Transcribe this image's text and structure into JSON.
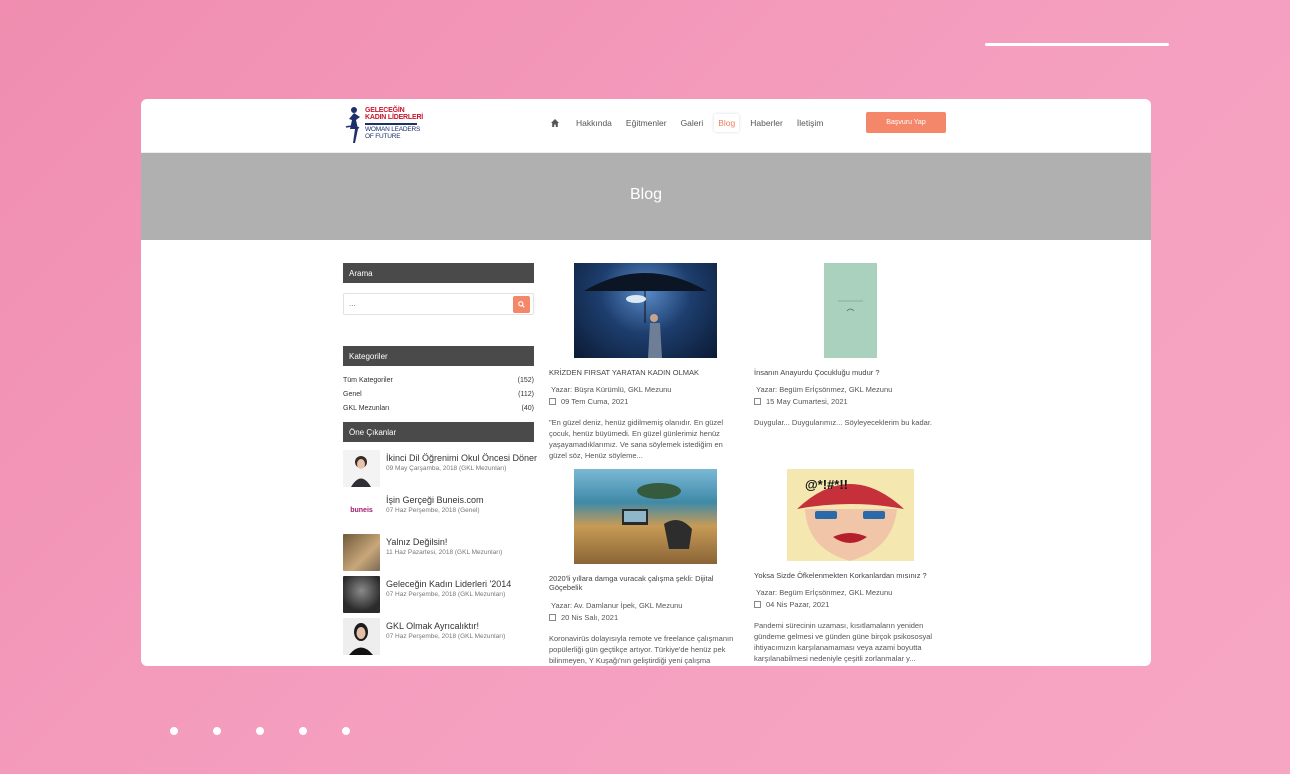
{
  "site": {
    "logo_tr": [
      "GELECEĞİN",
      "KADIN LİDERLERİ"
    ],
    "logo_en": [
      "WOMAN LEADERS",
      "OF FUTURE"
    ]
  },
  "nav": {
    "items": [
      "Hakkında",
      "Eğitmenler",
      "Galeri",
      "Blog",
      "Haberler",
      "İletişim"
    ],
    "active": "Blog",
    "apply_label": "Başvuru Yap"
  },
  "banner": {
    "title": "Blog"
  },
  "sidebar": {
    "search_title": "Arama",
    "search_placeholder": "...",
    "categories_title": "Kategoriler",
    "categories": [
      {
        "name": "Tüm Kategoriler",
        "count": "(152)"
      },
      {
        "name": "Genel",
        "count": "(112)"
      },
      {
        "name": "GKL Mezunları",
        "count": "(40)"
      }
    ],
    "featured_title": "Öne Çıkanlar",
    "featured": [
      {
        "title": "İkinci Dil Öğrenimi Okul Öncesi Döner",
        "meta": "09 May Çarşamba, 2018 (GKL Mezunları)"
      },
      {
        "title": "İşin Gerçeği Buneis.com",
        "meta": "07 Haz Perşembe, 2018 (Genel)",
        "thumb_text": "buneis"
      },
      {
        "title": "Yalnız Değilsin!",
        "meta": "11 Haz Pazartesi, 2018 (GKL Mezunları)"
      },
      {
        "title": "Geleceğin Kadın Liderleri '2014",
        "meta": "07 Haz Perşembe, 2018 (GKL Mezunları)"
      },
      {
        "title": "GKL Olmak Ayrıcalıktır!",
        "meta": "07 Haz Perşembe, 2018 (GKL Mezunları)"
      }
    ]
  },
  "posts": [
    {
      "title": "KRİZDEN FIRSAT YARATAN KADIN OLMAK",
      "author": "Yazar: Büşra Kürümlü, GKL Mezunu",
      "date": "09 Tem Cuma, 2021",
      "excerpt": "\"En güzel deniz, henüz gidilmemiş olanıdır.   En güzel çocuk, henüz büyümedi.   En güzel günlerimiz henüz yaşayamadıklarımız.   Ve sana söylemek istediğim en güzel söz,   Henüz söyleme..."
    },
    {
      "title": "İnsanın Anayurdu Çocukluğu mudur ?",
      "author": "Yazar: Begüm Erİçsönmez, GKL Mezunu",
      "date": "15 May Cumartesi, 2021",
      "excerpt": "Duygular... Duygularımız... Söyleyeceklerim bu kadar."
    },
    {
      "title": "2020'li yıllara damga vuracak çalışma şekli: Dijital Göçebelik",
      "author": "Yazar: Av. Damlanur İpek, GKL Mezunu",
      "date": "20 Nis Salı, 2021",
      "excerpt": "Koronavirüs dolayısıyla remote ve freelance çalışmanın popülerliği gün geçtikçe artıyor. Türkiye'de henüz pek bilinmeyen, Y Kuşağı'nın geliştirdiği yeni çalışma"
    },
    {
      "title": "Yoksa Sizde Öfkelenmekten Korkanlardan mısınız ?",
      "author": "Yazar: Begüm Erİçsönmez, GKL Mezunu",
      "date": "04 Nis Pazar, 2021",
      "excerpt": "Pandemi sürecinin uzaması, kısıtlamaların yeniden gündeme gelmesi ve günden güne birçok psikososyal ihtiyacımızın karşılanamaması veya azami boyutta karşılanabilmesi nedeniyle çeşitli zorlanmalar y..."
    }
  ]
}
